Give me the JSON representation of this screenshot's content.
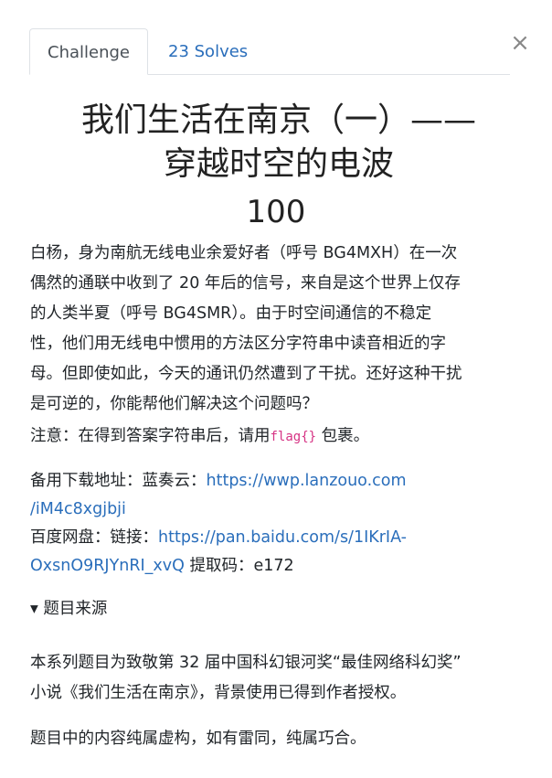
{
  "tabs": {
    "challenge": "Challenge",
    "solves": "23 Solves"
  },
  "close": "×",
  "challenge": {
    "title_line1": "我们生活在南京（一）——",
    "title_line2": "穿越时空的电波",
    "points": "100"
  },
  "description": {
    "intro_lines": [
      "白杨，身为南航无线电业余爱好者（呼号 BG4MXH）在一次",
      "偶然的通联中收到了 20 年后的信号，来自是这个世界上仅存",
      "的人类半夏（呼号 BG4SMR）。由于时空间通信的不稳定",
      "性，他们用无线电中惯用的方法区分字符串中读音相近的字",
      "母。但即使如此，今天的通讯仍然遭到了干扰。还好这种干扰",
      "是可逆的，你能帮他们解决这个问题吗？"
    ],
    "note_prefix": "注意：在得到答案字符串后，请用",
    "note_code": "flag{}",
    "note_suffix": "包裹。",
    "lanzou_label": "备用下载地址：蓝奏云：",
    "lanzou_url_part1": "https://wwp.lanzouo.com",
    "lanzou_url_part2": "/iM4c8xgjbji",
    "baidu_label": "百度网盘：链接：",
    "baidu_url_part1": "https://pan.baidu.com/s/1IKrIA-",
    "baidu_url_part2": "OxsnO9RJYnRI_xvQ",
    "baidu_code_text": "提取码：e172",
    "source_toggle": "▾ 题目来源",
    "series_lines": [
      "本系列题目为致敬第 32 届中国科幻银河奖“最佳网络科幻奖”",
      "小说《我们生活在南京》，背景使用已得到作者授权。"
    ],
    "fiction_note": "题目中的内容纯属虚构，如有雷同，纯属巧合。"
  }
}
